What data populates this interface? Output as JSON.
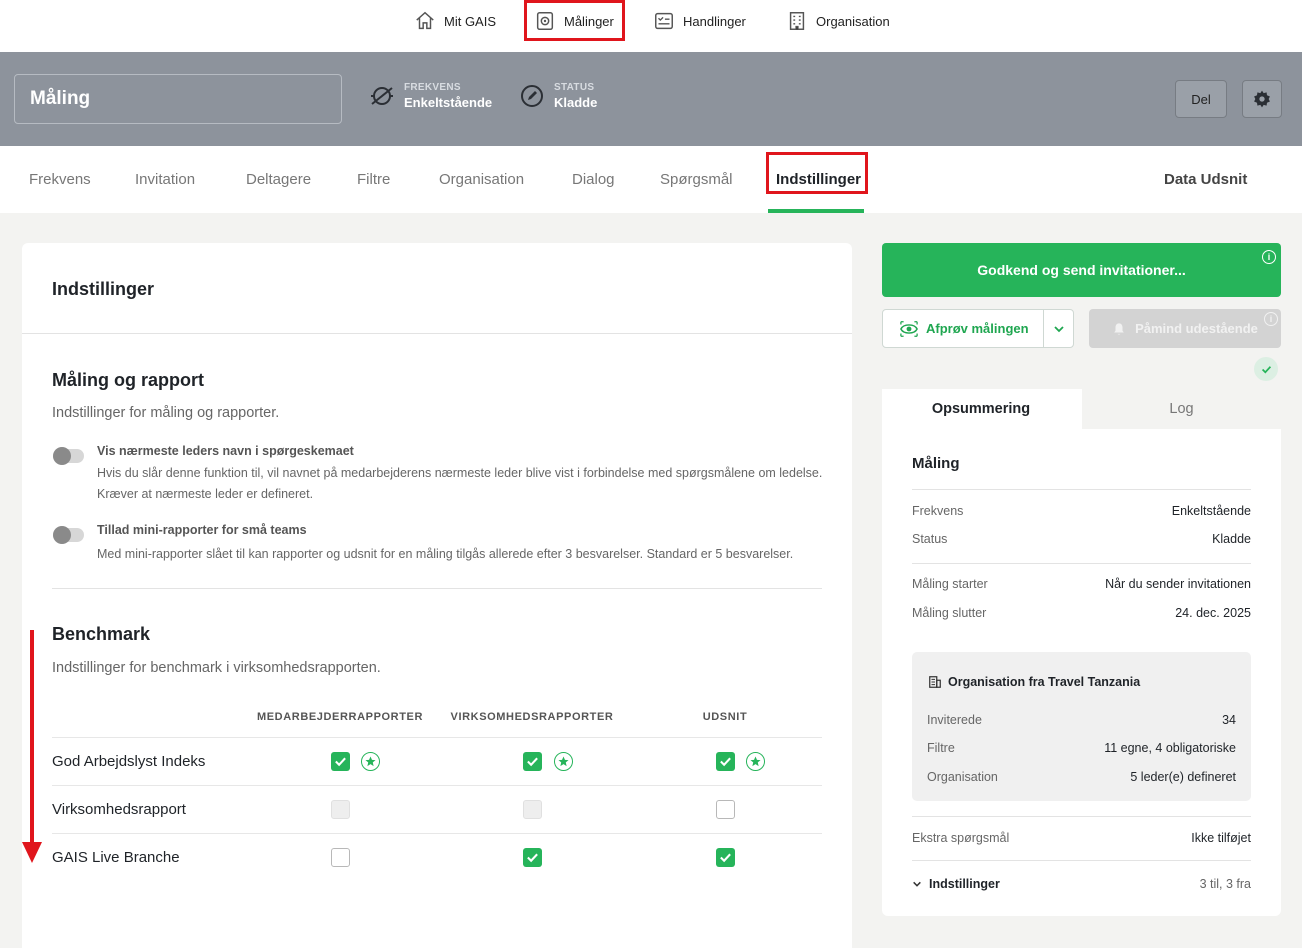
{
  "topnav": {
    "items": [
      {
        "label": "Mit GAIS",
        "icon": "home-icon"
      },
      {
        "label": "Målinger",
        "icon": "survey-icon"
      },
      {
        "label": "Handlinger",
        "icon": "actions-icon"
      },
      {
        "label": "Organisation",
        "icon": "building-icon"
      }
    ]
  },
  "header": {
    "title": "Måling",
    "frequency_label": "FREKVENS",
    "frequency_value": "Enkeltstående",
    "status_label": "STATUS",
    "status_value": "Kladde",
    "share_button": "Del"
  },
  "tabs": {
    "items": [
      "Frekvens",
      "Invitation",
      "Deltagere",
      "Filtre",
      "Organisation",
      "Dialog",
      "Spørgsmål",
      "Indstillinger"
    ],
    "active": "Indstillinger",
    "right": "Data Udsnit"
  },
  "settings": {
    "title": "Indstillinger",
    "measurement": {
      "heading": "Måling og rapport",
      "subtitle": "Indstillinger for måling og rapporter.",
      "options": [
        {
          "title": "Vis nærmeste leders navn i spørgeskemaet",
          "description": "Hvis du slår denne funktion til, vil navnet på medarbejderens nærmeste leder blive vist i forbindelse med spørgsmålene om ledelse. Kræver at nærmeste leder er defineret.",
          "enabled": false
        },
        {
          "title": "Tillad mini-rapporter for små teams",
          "description": "Med mini-rapporter slået til kan rapporter og udsnit for en måling tilgås allerede efter 3 besvarelser. Standard er 5 besvarelser.",
          "enabled": false
        }
      ]
    },
    "benchmark": {
      "heading": "Benchmark",
      "subtitle": "Indstillinger for benchmark i virksomhedsrapporten.",
      "columns": [
        "MEDARBEJDERRAPPORTER",
        "VIRKSOMHEDSRAPPORTER",
        "UDSNIT"
      ],
      "rows": [
        {
          "label": "God Arbejdslyst Indeks",
          "cells": [
            "checked-star",
            "checked-star",
            "checked-star"
          ]
        },
        {
          "label": "Virksomhedsrapport",
          "cells": [
            "disabled",
            "disabled",
            "unchecked"
          ]
        },
        {
          "label": "GAIS Live Branche",
          "cells": [
            "unchecked",
            "checked",
            "checked"
          ]
        }
      ]
    }
  },
  "actions": {
    "send_button": "Godkend og send invitationer...",
    "try_button": "Afprøv målingen",
    "remind_button": "Påmind udestående"
  },
  "summary": {
    "tabs": [
      "Opsummering",
      "Log"
    ],
    "active_tab": "Opsummering",
    "heading": "Måling",
    "rows": [
      {
        "key": "Frekvens",
        "value": "Enkeltstående"
      },
      {
        "key": "Status",
        "value": "Kladde"
      },
      {
        "key": "Måling starter",
        "value": "Når du sender invitationen"
      },
      {
        "key": "Måling slutter",
        "value": "24. dec. 2025"
      }
    ],
    "org": {
      "title": "Organisation fra Travel Tanzania",
      "rows": [
        {
          "key": "Inviterede",
          "value": "34"
        },
        {
          "key": "Filtre",
          "value": "11 egne, 4 obligatoriske"
        },
        {
          "key": "Organisation",
          "value": "5 leder(e) defineret"
        }
      ]
    },
    "extra": {
      "key": "Ekstra spørgsmål",
      "value": "Ikke tilføjet"
    },
    "settings_row": {
      "key": "Indstillinger",
      "value": "3 til, 3 fra"
    }
  },
  "colors": {
    "accent_green": "#26b45a",
    "header_gray": "#8d939c",
    "annotation_red": "#e0151c"
  }
}
